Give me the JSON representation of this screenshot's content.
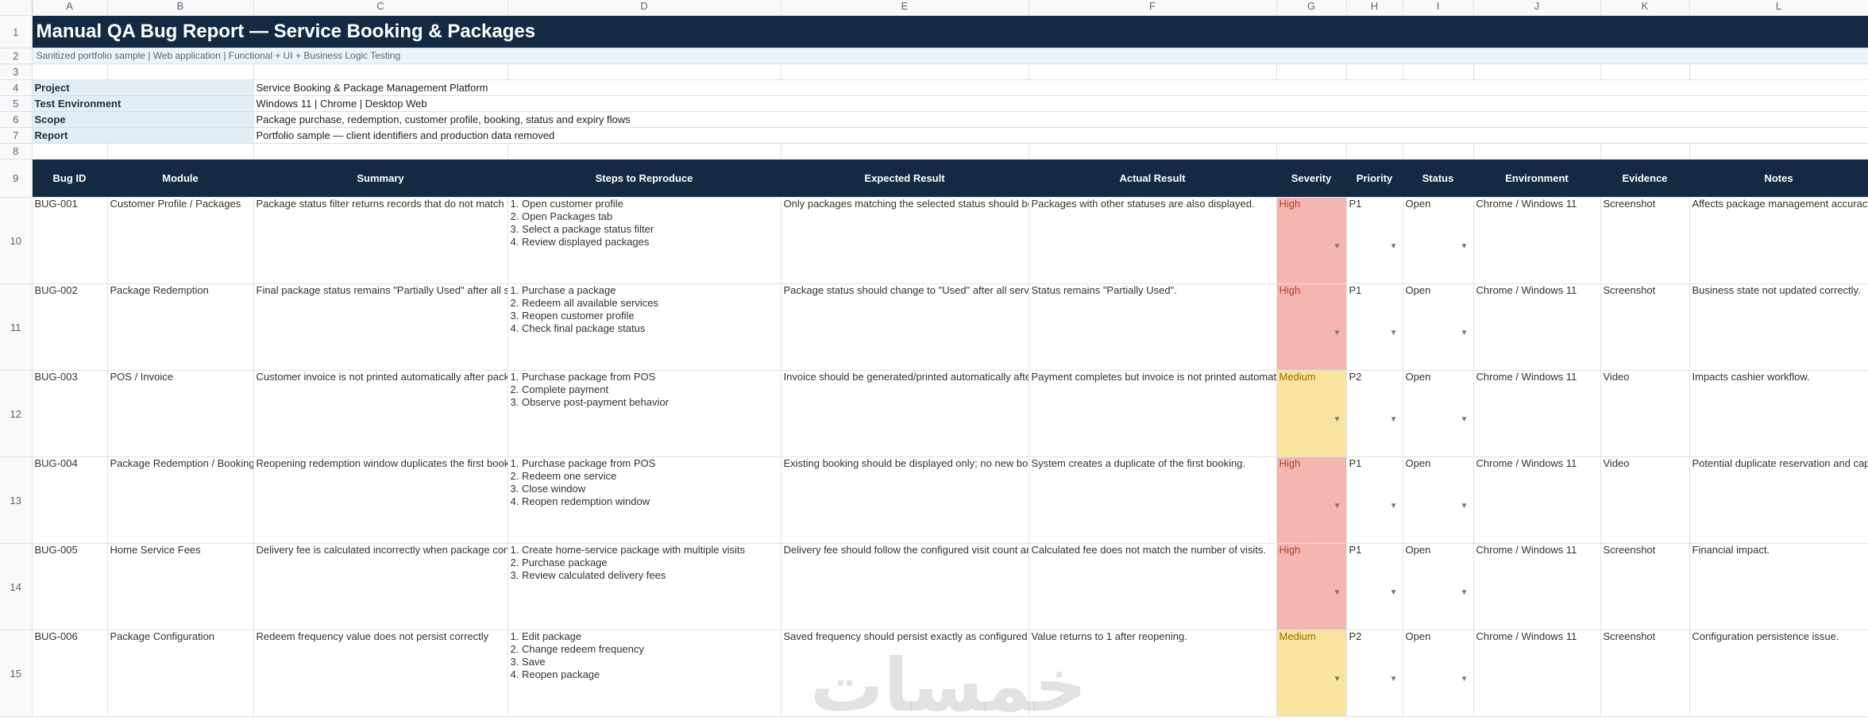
{
  "columns": [
    "A",
    "B",
    "C",
    "D",
    "E",
    "F",
    "G",
    "H",
    "I",
    "J",
    "K",
    "L"
  ],
  "title": "Manual QA Bug Report — Service Booking & Packages",
  "subtitle": "Sanitized portfolio sample | Web application | Functional + UI + Business Logic Testing",
  "meta": [
    {
      "label": "Project",
      "value": "Service Booking & Package Management Platform"
    },
    {
      "label": "Test Environment",
      "value": "Windows 11 | Chrome | Desktop Web"
    },
    {
      "label": "Scope",
      "value": "Package purchase, redemption, customer profile, booking, status and expiry flows"
    },
    {
      "label": "Report",
      "value": "Portfolio sample — client identifiers and production data removed"
    }
  ],
  "headers": [
    "Bug ID",
    "Module",
    "Summary",
    "Steps to Reproduce",
    "Expected Result",
    "Actual Result",
    "Severity",
    "Priority",
    "Status",
    "Environment",
    "Evidence",
    "Notes"
  ],
  "bugs": [
    {
      "row": "10",
      "id": "BUG-001",
      "module": "Customer Profile / Packages",
      "summary": "Package status filter returns records that do not match the selected status",
      "steps": [
        "1. Open customer profile",
        "2. Open Packages tab",
        "3. Select a package status filter",
        "4. Review displayed packages"
      ],
      "expected": "Only packages matching the selected status should be displayed.",
      "actual": "Packages with other statuses are also displayed.",
      "severity": "High",
      "priority": "P1",
      "status": "Open",
      "environment": "Chrome / Windows 11",
      "evidence": "Screenshot",
      "notes": "Affects package management accuracy."
    },
    {
      "row": "11",
      "id": "BUG-002",
      "module": "Package Redemption",
      "summary": "Final package status remains \"Partially Used\" after all services are redeemed",
      "steps": [
        "1. Purchase a package",
        "2. Redeem all available services",
        "3. Reopen customer profile",
        "4. Check final package status"
      ],
      "expected": "Package status should change to \"Used\" after all services are redeemed.",
      "actual": "Status remains \"Partially Used\".",
      "severity": "High",
      "priority": "P1",
      "status": "Open",
      "environment": "Chrome / Windows 11",
      "evidence": "Screenshot",
      "notes": "Business state not updated correctly."
    },
    {
      "row": "12",
      "id": "BUG-003",
      "module": "POS / Invoice",
      "summary": "Customer invoice is not printed automatically after package payment",
      "steps": [
        "1. Purchase package from POS",
        "2. Complete payment",
        "3. Observe post-payment behavior"
      ],
      "expected": "Invoice should be generated/printed automatically after successful payment.",
      "actual": "Payment completes but invoice is not printed automatically.",
      "severity": "Medium",
      "priority": "P2",
      "status": "Open",
      "environment": "Chrome / Windows 11",
      "evidence": "Video",
      "notes": "Impacts cashier workflow."
    },
    {
      "row": "13",
      "id": "BUG-004",
      "module": "Package Redemption / Booking",
      "summary": "Reopening redemption window duplicates the first booking without user action",
      "steps": [
        "1. Purchase package from POS",
        "2. Redeem one service",
        "3. Close window",
        "4. Reopen redemption window"
      ],
      "expected": "Existing booking should be displayed only; no new booking should be created automatically.",
      "actual": "System creates a duplicate of the first booking.",
      "severity": "High",
      "priority": "P1",
      "status": "Open",
      "environment": "Chrome / Windows 11",
      "evidence": "Video",
      "notes": "Potential duplicate reservation and capacity issue."
    },
    {
      "row": "14",
      "id": "BUG-005",
      "module": "Home Service Fees",
      "summary": "Delivery fee is calculated incorrectly when package contains multiple home visits",
      "steps": [
        "1. Create home-service package with multiple visits",
        "2. Purchase package",
        "3. Review calculated delivery fees"
      ],
      "expected": "Delivery fee should follow the configured visit count and pricing rule.",
      "actual": "Calculated fee does not match the number of visits.",
      "severity": "High",
      "priority": "P1",
      "status": "Open",
      "environment": "Chrome / Windows 11",
      "evidence": "Screenshot",
      "notes": "Financial impact."
    },
    {
      "row": "15",
      "id": "BUG-006",
      "module": "Package Configuration",
      "summary": "Redeem frequency value does not persist correctly",
      "steps": [
        "1. Edit package",
        "2. Change redeem frequency",
        "3. Save",
        "4. Reopen package"
      ],
      "expected": "Saved frequency should persist exactly as configured.",
      "actual": "Value returns to 1 after reopening.",
      "severity": "Medium",
      "priority": "P2",
      "status": "Open",
      "environment": "Chrome / Windows 11",
      "evidence": "Screenshot",
      "notes": "Configuration persistence issue."
    }
  ],
  "watermark": "خمسات",
  "colors": {
    "header_bg": "#142a42",
    "high": "#f4b6b0",
    "medium": "#f8e49e"
  }
}
